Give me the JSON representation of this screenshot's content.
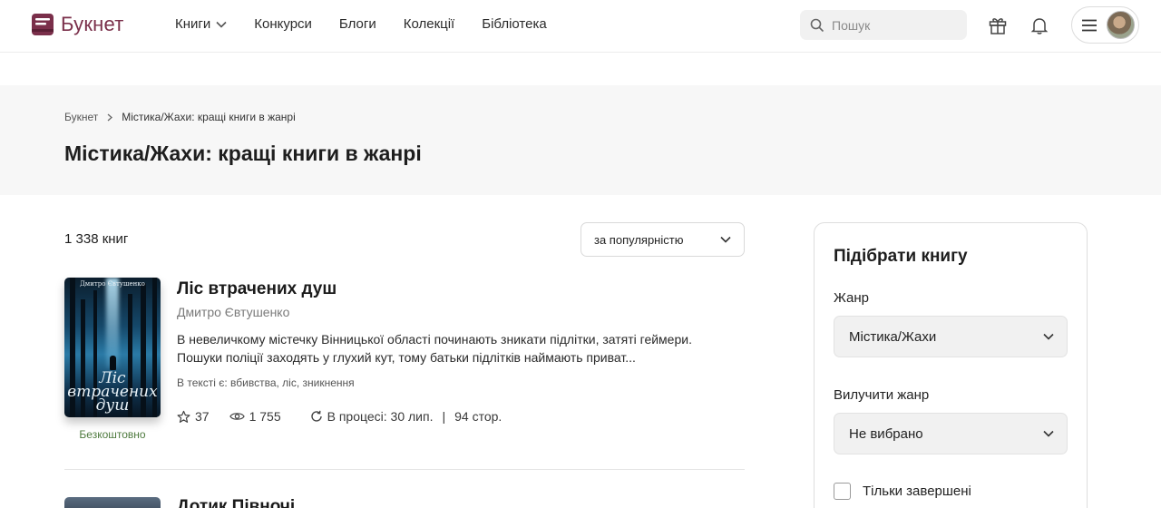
{
  "header": {
    "logo_text": "Букнет",
    "nav": [
      {
        "label": "Книги"
      },
      {
        "label": "Конкурси"
      },
      {
        "label": "Блоги"
      },
      {
        "label": "Колекції"
      },
      {
        "label": "Бібліотека"
      }
    ],
    "search_placeholder": "Пошук",
    "icons": [
      "gift-icon",
      "bell-icon",
      "menu-icon"
    ],
    "brand_color": "#7a2f4a"
  },
  "breadcrumb": {
    "home": "Букнет",
    "current": "Містика/Жахи: кращі книги в жанрі"
  },
  "page_title": "Містика/Жахи: кращі книги в жанрі",
  "results": {
    "count": "1 338 книг",
    "sort_value": "за популярністю"
  },
  "books": [
    {
      "title": "Ліс втрачених душ",
      "author": "Дмитро Євтушенко",
      "cover_author": "Дмитро Євтушенко",
      "cover_title": "Ліс втрачених душ",
      "price_label": "Безкоштовно",
      "description": "В невеличкому містечку Вінницької області починають зникати підлітки, затяті геймери. Пошуки поліції заходять у глухий кут, тому батьки підлітків наймають приват...",
      "tags": "В тексті є: вбивства, ліс, зникнення",
      "likes": "37",
      "views": "1 755",
      "status": "В процесі: 30 лип.",
      "pages": "94 стор."
    },
    {
      "title": "Дотик Півночі"
    }
  ],
  "filter": {
    "title": "Підібрати книгу",
    "genre_label": "Жанр",
    "genre_value": "Містика/Жахи",
    "exclude_label": "Вилучити жанр",
    "exclude_value": "Не вибрано",
    "completed_label": "Тільки завершені"
  }
}
